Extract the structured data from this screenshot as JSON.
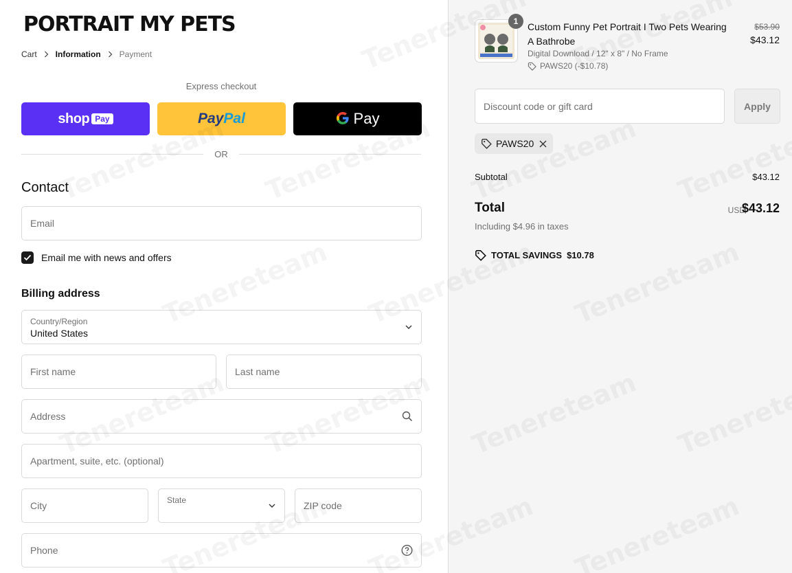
{
  "store": {
    "name": "PORTRAIT MY PETS"
  },
  "breadcrumb": {
    "cart": "Cart",
    "information": "Information",
    "payment": "Payment"
  },
  "express": {
    "label": "Express checkout",
    "shop_word": "shop",
    "shop_pay": "Pay",
    "paypal_part1": "Pay",
    "paypal_part2": "Pal",
    "gpay_word": "Pay",
    "or": "OR"
  },
  "contact": {
    "title": "Contact",
    "email_placeholder": "Email",
    "newsletter_label": "Email me with news and offers",
    "newsletter_checked": true
  },
  "billing": {
    "title": "Billing address",
    "country_label": "Country/Region",
    "country_value": "United States",
    "first_name": "First name",
    "last_name": "Last name",
    "address": "Address",
    "apartment": "Apartment, suite, etc. (optional)",
    "city": "City",
    "state": "State",
    "zip": "ZIP code",
    "phone": "Phone"
  },
  "order": {
    "quantity": "1",
    "product_title": "Custom Funny Pet Portrait I Two Pets Wearing A Bathrobe",
    "variant": "Digital Download / 12\" x 8\" / No Frame",
    "discount_applied": "PAWS20 (-$10.78)",
    "original_price": "$53.90",
    "price": "$43.12",
    "discount_placeholder": "Discount code or gift card",
    "apply_label": "Apply",
    "discount_tag": "PAWS20",
    "subtotal_label": "Subtotal",
    "subtotal_value": "$43.12",
    "total_label": "Total",
    "currency": "USD",
    "total_value": "$43.12",
    "taxes_note": "Including $4.96 in taxes",
    "savings_label": "TOTAL SAVINGS",
    "savings_value": "$10.78"
  },
  "watermark": "Tenereteam",
  "colors": {
    "shop_pay": "#5a31f4",
    "paypal": "#ffc439",
    "gpay": "#000000"
  }
}
